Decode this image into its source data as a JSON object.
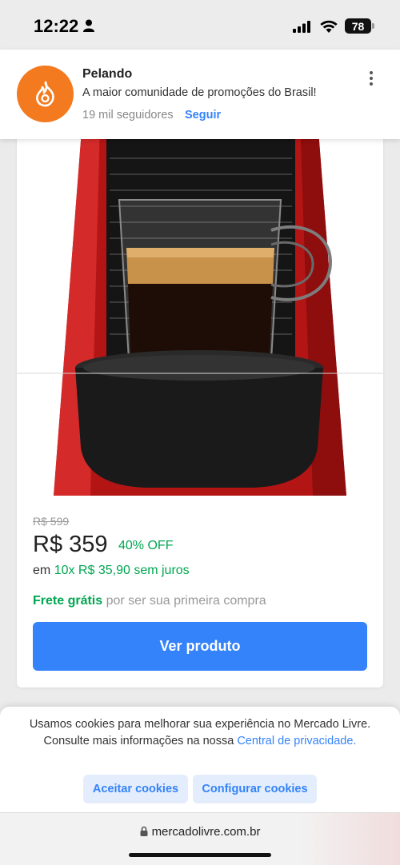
{
  "status_bar": {
    "time": "12:22",
    "battery": "78"
  },
  "notification": {
    "title": "Pelando",
    "subtitle": "A maior comunidade de promoções do Brasil!",
    "followers": "19 mil seguidores",
    "follow_label": "Seguir",
    "brand_color": "#f37a1f"
  },
  "product": {
    "old_price": "R$ 599",
    "price": "R$ 359",
    "discount": "40% OFF",
    "installments_prefix": "em",
    "installments_value": "10x R$ 35,90 sem juros",
    "shipping_highlight": "Frete grátis",
    "shipping_rest": "por ser sua primeira compra",
    "cta_label": "Ver produto",
    "accent_color": "#3483fa",
    "green_color": "#00a650"
  },
  "cookie_banner": {
    "text": "Usamos cookies para melhorar sua experiência no Mercado Livre. Consulte mais informações na nossa",
    "link_text": "Central de privacidade.",
    "accept_label": "Aceitar cookies",
    "config_label": "Configurar cookies"
  },
  "browser": {
    "url": "mercadolivre.com.br"
  }
}
